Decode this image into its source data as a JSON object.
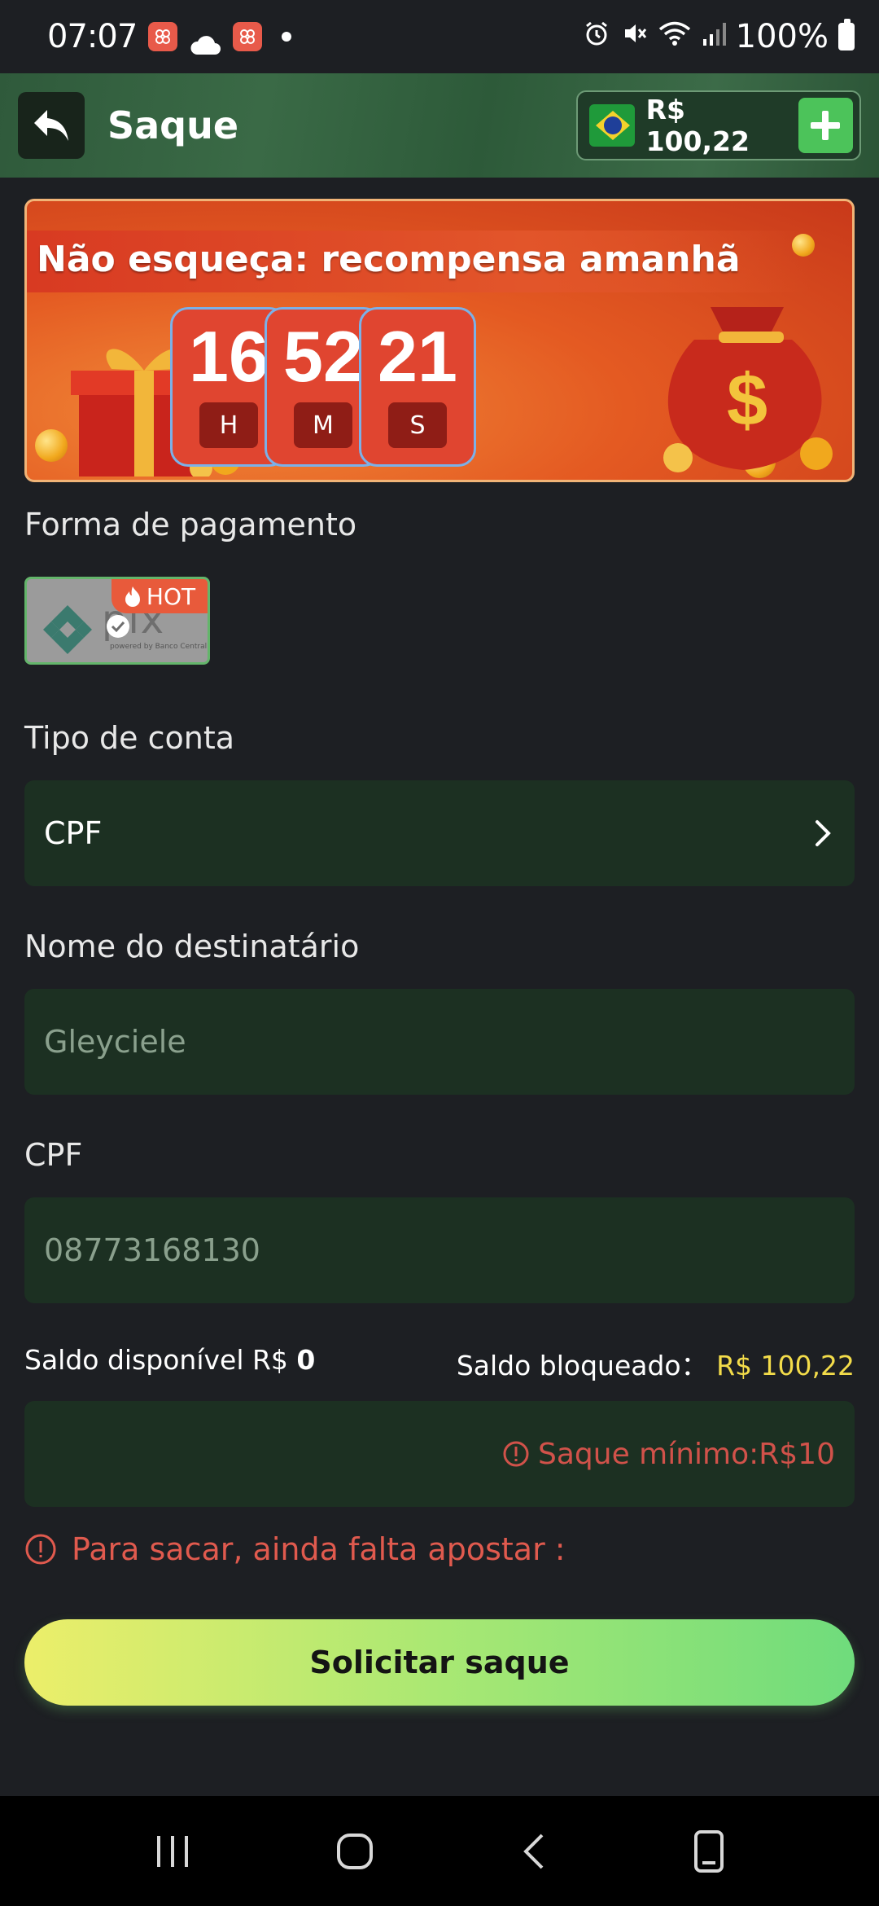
{
  "status_bar": {
    "time": "07:07",
    "battery": "100%",
    "icons": [
      "app-notification-icon",
      "cloud-icon",
      "app-notification-icon",
      "dot-icon",
      "alarm-icon",
      "mute-icon",
      "wifi-icon",
      "signal-icon",
      "battery-icon"
    ]
  },
  "header": {
    "title": "Saque",
    "balance": "R$ 100,22",
    "back_icon": "back-arrow-icon",
    "add_icon": "plus-icon",
    "flag_icon": "brazil-flag-icon"
  },
  "banner": {
    "title": "Não esqueça: recompensa amanhã",
    "hours": "16",
    "minutes": "52",
    "seconds": "21",
    "hours_unit": "H",
    "minutes_unit": "M",
    "seconds_unit": "S"
  },
  "payment": {
    "label": "Forma de pagamento",
    "method_name": "pix",
    "method_subtitle": "powered by Banco Central",
    "badge": "HOT"
  },
  "account_type": {
    "label": "Tipo de conta",
    "value": "CPF"
  },
  "recipient": {
    "label": "Nome do destinatário",
    "value": "Gleyciele"
  },
  "cpf": {
    "label": "CPF",
    "value": "08773168130"
  },
  "balances": {
    "available_label": "Saldo disponível R$",
    "available_value": "0",
    "blocked_label": "Saldo bloqueado：",
    "blocked_value": "R$ 100,22"
  },
  "amount": {
    "placeholder": "Saque mínimo:R$10"
  },
  "warning": {
    "text": "Para sacar, ainda falta apostar :"
  },
  "submit": {
    "label": "Solicitar saque"
  },
  "colors": {
    "accent_green": "#4cc35a",
    "field_bg": "#1c3022",
    "error_red": "#e05a4e",
    "blocked_yellow": "#f3dc4a"
  }
}
